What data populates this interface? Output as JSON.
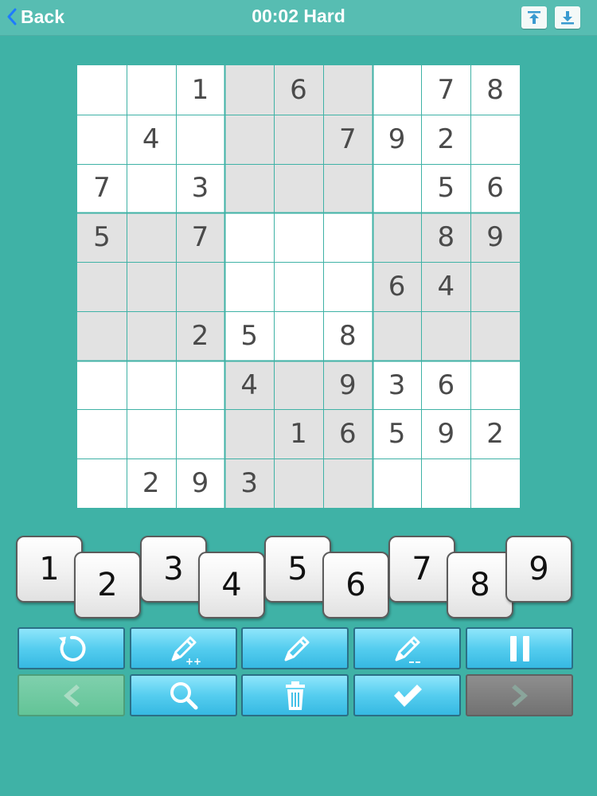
{
  "colors": {
    "background": "#3fb2a6",
    "top_bar": "#57bdb2",
    "shaded_cell": "#e2e2e2",
    "grid_line": "#3fb2a6",
    "given_digit": "#4a4a4a"
  },
  "header": {
    "back_label": "Back",
    "timer": "00:02",
    "difficulty": "Hard",
    "title": "00:02 Hard",
    "icons": [
      "chevron-left-icon",
      "upload-icon",
      "download-icon"
    ]
  },
  "board": {
    "shaded_boxes": [
      1,
      3,
      5,
      7
    ],
    "rows": [
      [
        "",
        "",
        "1",
        "",
        "6",
        "",
        "",
        "7",
        "8"
      ],
      [
        "",
        "4",
        "",
        "",
        "",
        "7",
        "9",
        "2",
        ""
      ],
      [
        "7",
        "",
        "3",
        "",
        "",
        "",
        "",
        "5",
        "6"
      ],
      [
        "5",
        "",
        "7",
        "",
        "",
        "",
        "",
        "8",
        "9"
      ],
      [
        "",
        "",
        "",
        "",
        "",
        "",
        "6",
        "4",
        ""
      ],
      [
        "",
        "",
        "2",
        "5",
        "",
        "8",
        "",
        "",
        ""
      ],
      [
        "",
        "",
        "",
        "4",
        "",
        "9",
        "3",
        "6",
        ""
      ],
      [
        "",
        "",
        "",
        "",
        "1",
        "6",
        "5",
        "9",
        "2"
      ],
      [
        "",
        "2",
        "9",
        "3",
        "",
        "",
        "",
        "",
        ""
      ]
    ]
  },
  "keypad": {
    "keys": [
      "1",
      "2",
      "3",
      "4",
      "5",
      "6",
      "7",
      "8",
      "9"
    ]
  },
  "tools": {
    "row1": [
      "refresh-icon",
      "pencil-plus-icon",
      "pencil-icon",
      "pencil-minus-icon",
      "pause-icon"
    ],
    "row2": [
      "arrow-left-icon",
      "search-icon",
      "trash-icon",
      "check-icon",
      "arrow-right-icon"
    ]
  }
}
